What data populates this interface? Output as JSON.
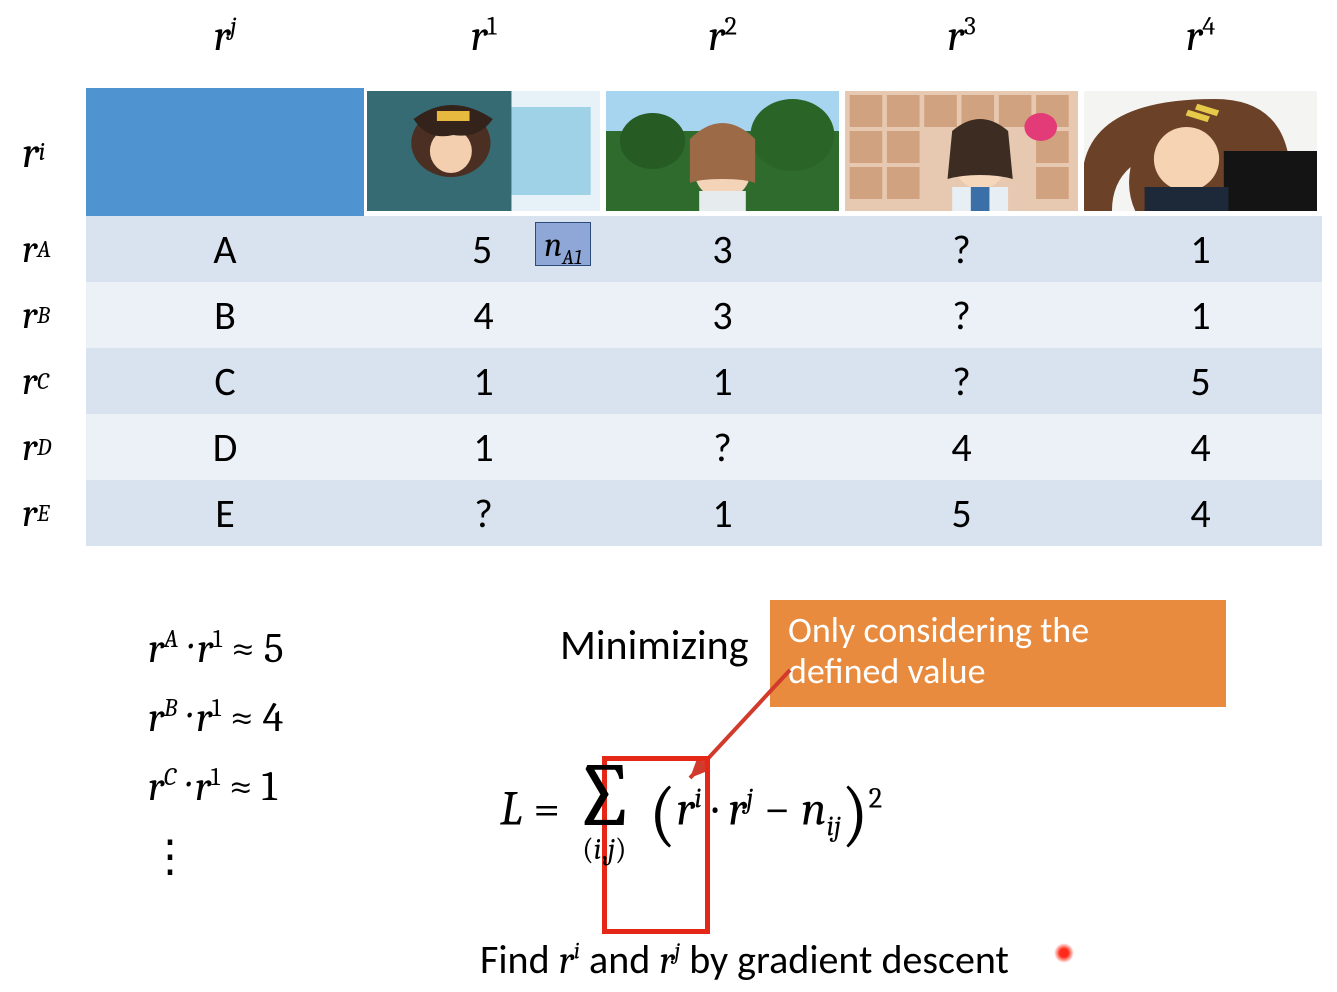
{
  "table": {
    "corner_j": "r",
    "corner_j_sup": "j",
    "corner_i": "r",
    "corner_i_sup": "i",
    "col_headers": [
      {
        "base": "r",
        "sup": "1"
      },
      {
        "base": "r",
        "sup": "2"
      },
      {
        "base": "r",
        "sup": "3"
      },
      {
        "base": "r",
        "sup": "4"
      }
    ],
    "row_labels": [
      {
        "base": "r",
        "sup": "A"
      },
      {
        "base": "r",
        "sup": "B"
      },
      {
        "base": "r",
        "sup": "C"
      },
      {
        "base": "r",
        "sup": "D"
      },
      {
        "base": "r",
        "sup": "E"
      }
    ],
    "users": [
      "A",
      "B",
      "C",
      "D",
      "E"
    ],
    "values": [
      [
        "5",
        "3",
        "?",
        "1"
      ],
      [
        "4",
        "3",
        "?",
        "1"
      ],
      [
        "1",
        "1",
        "?",
        "5"
      ],
      [
        "1",
        "?",
        "4",
        "4"
      ],
      [
        "?",
        "1",
        "5",
        "4"
      ]
    ],
    "note_cell": {
      "text": "n",
      "sub": "A1"
    }
  },
  "approx": [
    {
      "a_base": "r",
      "a_sup": "A",
      "b_base": "r",
      "b_sup": "1",
      "rhs": "5"
    },
    {
      "a_base": "r",
      "a_sup": "B",
      "b_base": "r",
      "b_sup": "1",
      "rhs": "4"
    },
    {
      "a_base": "r",
      "a_sup": "C",
      "b_base": "r",
      "b_sup": "1",
      "rhs": "1"
    }
  ],
  "text": {
    "minimizing": "Minimizing",
    "callout_l1": "Only considering the",
    "callout_l2": "defined value",
    "find": "Find ",
    "find_mid": " and ",
    "find_end": " by gradient descent",
    "vdots": "⋮"
  },
  "loss": {
    "L": "L",
    "eq": " = ",
    "sum": "∑",
    "sum_sub_open": "(",
    "sum_sub_i": "i",
    "sum_sub_comma": ",",
    "sum_sub_j": "j",
    "sum_sub_close": ")",
    "lpar": "(",
    "ri": "r",
    "ri_sup": "i",
    "dot": " · ",
    "rj": "r",
    "rj_sup": "j",
    "minus": " − ",
    "n": "n",
    "n_sub": "ij",
    "rpar": ")",
    "sq": "2"
  },
  "find_vars": {
    "ri": "r",
    "ri_sup": "i",
    "rj": "r",
    "rj_sup": "j"
  }
}
